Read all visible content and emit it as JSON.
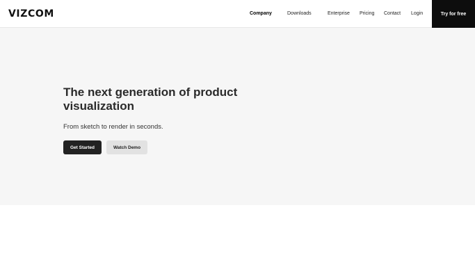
{
  "header": {
    "logo": "VIZCOM",
    "nav": [
      {
        "label": "Company",
        "active": true
      },
      {
        "label": "Downloads",
        "active": false
      },
      {
        "label": "Enterprise",
        "active": false
      },
      {
        "label": "Pricing",
        "active": false
      },
      {
        "label": "Contact",
        "active": false
      },
      {
        "label": "Login",
        "active": false
      }
    ],
    "cta_label": "Try for free"
  },
  "hero": {
    "title": "The next generation of product visualization",
    "subtitle": "From sketch to render in seconds.",
    "primary_button": "Get Started",
    "secondary_button": "Watch Demo"
  },
  "colors": {
    "hero_background": "#f6f6f6",
    "primary_button": "#222222",
    "secondary_button": "#e2e2e2",
    "cta_background": "#0d0d0d"
  }
}
